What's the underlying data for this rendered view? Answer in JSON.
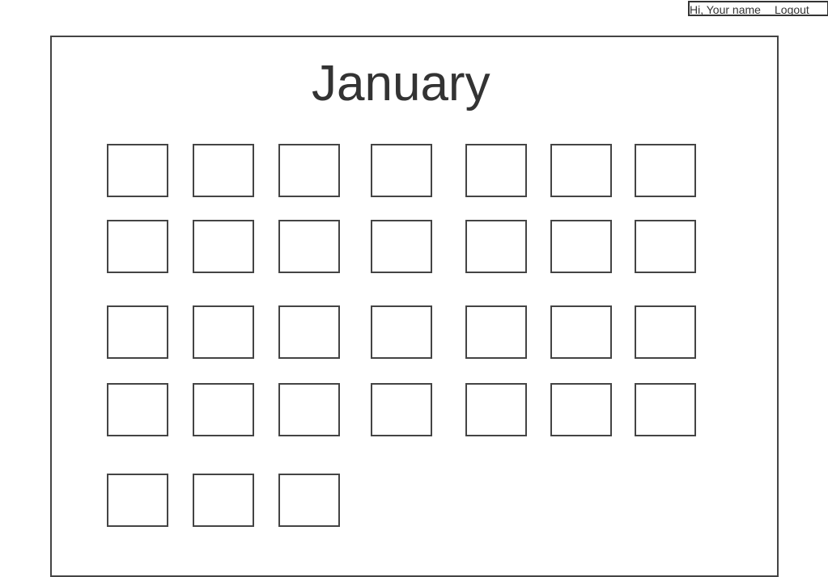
{
  "user_bar": {
    "greeting": "Hi, Your name",
    "logout_label": "Logout"
  },
  "calendar": {
    "month": "January",
    "day_count": 31
  }
}
